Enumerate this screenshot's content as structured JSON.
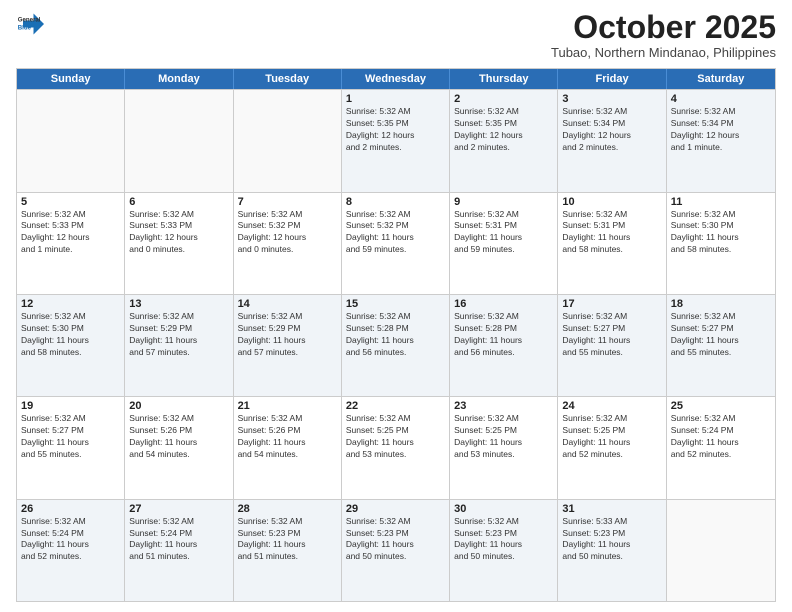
{
  "header": {
    "logo_line1": "General",
    "logo_line2": "Blue",
    "main_title": "October 2025",
    "subtitle": "Tubao, Northern Mindanao, Philippines"
  },
  "days_of_week": [
    "Sunday",
    "Monday",
    "Tuesday",
    "Wednesday",
    "Thursday",
    "Friday",
    "Saturday"
  ],
  "weeks": [
    [
      {
        "day": "",
        "info": "",
        "empty": true
      },
      {
        "day": "",
        "info": "",
        "empty": true
      },
      {
        "day": "",
        "info": "",
        "empty": true
      },
      {
        "day": "1",
        "info": "Sunrise: 5:32 AM\nSunset: 5:35 PM\nDaylight: 12 hours\nand 2 minutes.",
        "empty": false
      },
      {
        "day": "2",
        "info": "Sunrise: 5:32 AM\nSunset: 5:35 PM\nDaylight: 12 hours\nand 2 minutes.",
        "empty": false
      },
      {
        "day": "3",
        "info": "Sunrise: 5:32 AM\nSunset: 5:34 PM\nDaylight: 12 hours\nand 2 minutes.",
        "empty": false
      },
      {
        "day": "4",
        "info": "Sunrise: 5:32 AM\nSunset: 5:34 PM\nDaylight: 12 hours\nand 1 minute.",
        "empty": false
      }
    ],
    [
      {
        "day": "5",
        "info": "Sunrise: 5:32 AM\nSunset: 5:33 PM\nDaylight: 12 hours\nand 1 minute.",
        "empty": false
      },
      {
        "day": "6",
        "info": "Sunrise: 5:32 AM\nSunset: 5:33 PM\nDaylight: 12 hours\nand 0 minutes.",
        "empty": false
      },
      {
        "day": "7",
        "info": "Sunrise: 5:32 AM\nSunset: 5:32 PM\nDaylight: 12 hours\nand 0 minutes.",
        "empty": false
      },
      {
        "day": "8",
        "info": "Sunrise: 5:32 AM\nSunset: 5:32 PM\nDaylight: 11 hours\nand 59 minutes.",
        "empty": false
      },
      {
        "day": "9",
        "info": "Sunrise: 5:32 AM\nSunset: 5:31 PM\nDaylight: 11 hours\nand 59 minutes.",
        "empty": false
      },
      {
        "day": "10",
        "info": "Sunrise: 5:32 AM\nSunset: 5:31 PM\nDaylight: 11 hours\nand 58 minutes.",
        "empty": false
      },
      {
        "day": "11",
        "info": "Sunrise: 5:32 AM\nSunset: 5:30 PM\nDaylight: 11 hours\nand 58 minutes.",
        "empty": false
      }
    ],
    [
      {
        "day": "12",
        "info": "Sunrise: 5:32 AM\nSunset: 5:30 PM\nDaylight: 11 hours\nand 58 minutes.",
        "empty": false
      },
      {
        "day": "13",
        "info": "Sunrise: 5:32 AM\nSunset: 5:29 PM\nDaylight: 11 hours\nand 57 minutes.",
        "empty": false
      },
      {
        "day": "14",
        "info": "Sunrise: 5:32 AM\nSunset: 5:29 PM\nDaylight: 11 hours\nand 57 minutes.",
        "empty": false
      },
      {
        "day": "15",
        "info": "Sunrise: 5:32 AM\nSunset: 5:28 PM\nDaylight: 11 hours\nand 56 minutes.",
        "empty": false
      },
      {
        "day": "16",
        "info": "Sunrise: 5:32 AM\nSunset: 5:28 PM\nDaylight: 11 hours\nand 56 minutes.",
        "empty": false
      },
      {
        "day": "17",
        "info": "Sunrise: 5:32 AM\nSunset: 5:27 PM\nDaylight: 11 hours\nand 55 minutes.",
        "empty": false
      },
      {
        "day": "18",
        "info": "Sunrise: 5:32 AM\nSunset: 5:27 PM\nDaylight: 11 hours\nand 55 minutes.",
        "empty": false
      }
    ],
    [
      {
        "day": "19",
        "info": "Sunrise: 5:32 AM\nSunset: 5:27 PM\nDaylight: 11 hours\nand 55 minutes.",
        "empty": false
      },
      {
        "day": "20",
        "info": "Sunrise: 5:32 AM\nSunset: 5:26 PM\nDaylight: 11 hours\nand 54 minutes.",
        "empty": false
      },
      {
        "day": "21",
        "info": "Sunrise: 5:32 AM\nSunset: 5:26 PM\nDaylight: 11 hours\nand 54 minutes.",
        "empty": false
      },
      {
        "day": "22",
        "info": "Sunrise: 5:32 AM\nSunset: 5:25 PM\nDaylight: 11 hours\nand 53 minutes.",
        "empty": false
      },
      {
        "day": "23",
        "info": "Sunrise: 5:32 AM\nSunset: 5:25 PM\nDaylight: 11 hours\nand 53 minutes.",
        "empty": false
      },
      {
        "day": "24",
        "info": "Sunrise: 5:32 AM\nSunset: 5:25 PM\nDaylight: 11 hours\nand 52 minutes.",
        "empty": false
      },
      {
        "day": "25",
        "info": "Sunrise: 5:32 AM\nSunset: 5:24 PM\nDaylight: 11 hours\nand 52 minutes.",
        "empty": false
      }
    ],
    [
      {
        "day": "26",
        "info": "Sunrise: 5:32 AM\nSunset: 5:24 PM\nDaylight: 11 hours\nand 52 minutes.",
        "empty": false
      },
      {
        "day": "27",
        "info": "Sunrise: 5:32 AM\nSunset: 5:24 PM\nDaylight: 11 hours\nand 51 minutes.",
        "empty": false
      },
      {
        "day": "28",
        "info": "Sunrise: 5:32 AM\nSunset: 5:23 PM\nDaylight: 11 hours\nand 51 minutes.",
        "empty": false
      },
      {
        "day": "29",
        "info": "Sunrise: 5:32 AM\nSunset: 5:23 PM\nDaylight: 11 hours\nand 50 minutes.",
        "empty": false
      },
      {
        "day": "30",
        "info": "Sunrise: 5:32 AM\nSunset: 5:23 PM\nDaylight: 11 hours\nand 50 minutes.",
        "empty": false
      },
      {
        "day": "31",
        "info": "Sunrise: 5:33 AM\nSunset: 5:23 PM\nDaylight: 11 hours\nand 50 minutes.",
        "empty": false
      },
      {
        "day": "",
        "info": "",
        "empty": true
      }
    ]
  ]
}
